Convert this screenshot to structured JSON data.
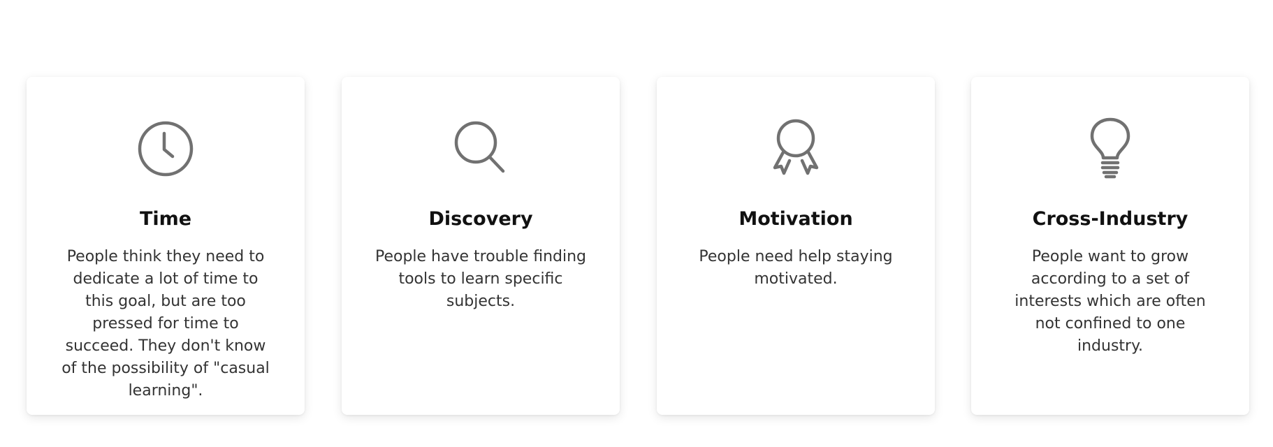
{
  "cards": [
    {
      "icon": "clock-icon",
      "title": "Time",
      "text": "People think they need to dedicate a lot of time to this goal, but are too pressed for time to succeed. They don't know of the possibility of \"casual learning\"."
    },
    {
      "icon": "search-icon",
      "title": "Discovery",
      "text": "People have trouble finding tools to learn specific subjects."
    },
    {
      "icon": "award-icon",
      "title": "Motivation",
      "text": "People need help staying motivated."
    },
    {
      "icon": "lightbulb-icon",
      "title": "Cross-Industry",
      "text": "People want to grow according to a set of interests which are often not confined to one industry."
    }
  ],
  "colors": {
    "icon": "#717171",
    "title": "#111111",
    "text": "#333333",
    "card_background": "#ffffff"
  }
}
